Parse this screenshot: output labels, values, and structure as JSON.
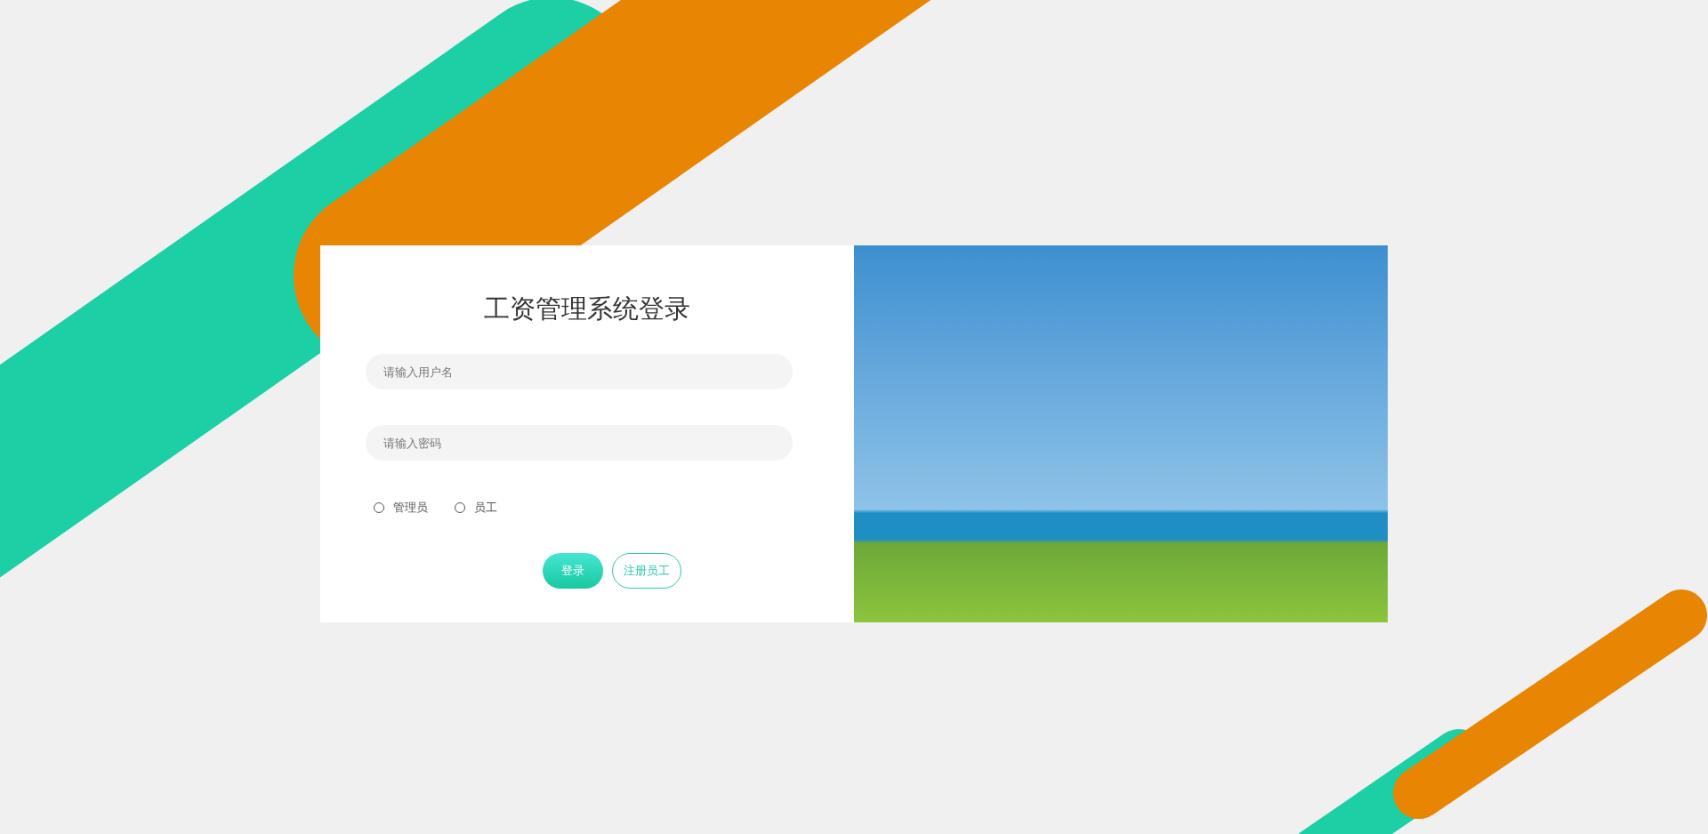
{
  "login": {
    "title": "工资管理系统登录",
    "fields": [
      {
        "placeholder": "请输入用户名"
      },
      {
        "placeholder": "请输入密码"
      }
    ],
    "roles": [
      {
        "label": "管理员",
        "checked": false
      },
      {
        "label": "员工",
        "checked": false
      }
    ],
    "buttons": [
      {
        "kind": "primary",
        "label": "登录"
      },
      {
        "kind": "outline",
        "label": "注册员工"
      }
    ]
  }
}
